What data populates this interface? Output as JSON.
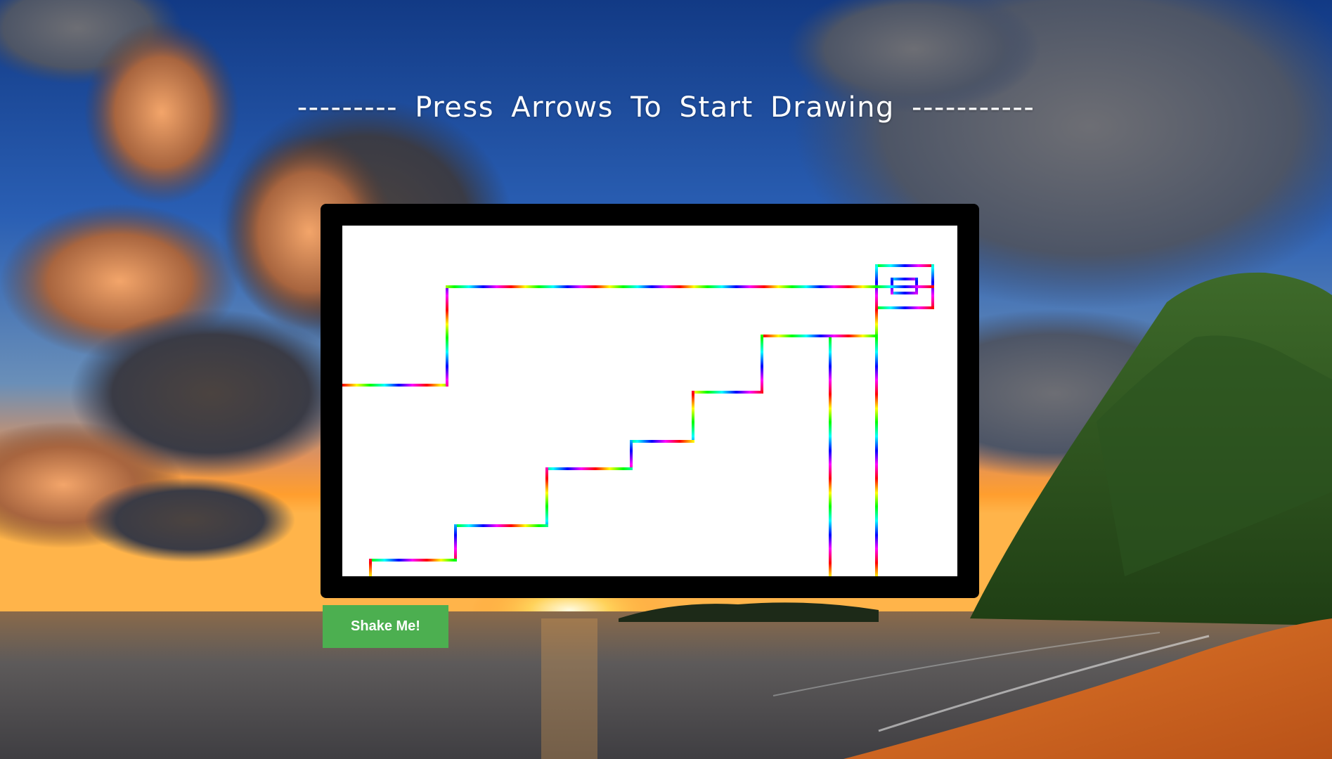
{
  "page": {
    "heading": "--------- Press Arrows To Start Drawing -----------"
  },
  "button": {
    "shake_label": "Shake Me!",
    "color": "#4caf50"
  },
  "etch_a_sketch": {
    "frame_color": "#000000",
    "canvas_color": "#ffffff",
    "stroke_palette": [
      "#ff0000",
      "#ffff00",
      "#00ff00",
      "#00ffff",
      "#0000ff",
      "#ff00ff"
    ]
  }
}
